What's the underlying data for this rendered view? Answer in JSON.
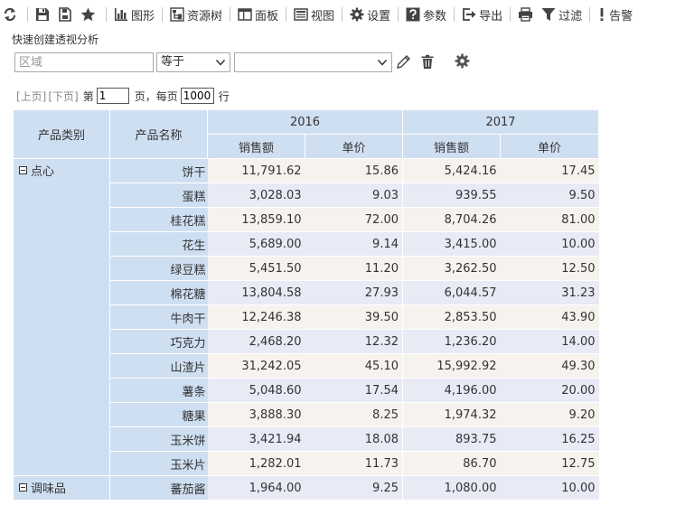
{
  "toolbar": {
    "items": [
      {
        "icon": "refresh-icon",
        "label": ""
      },
      {
        "icon": "save-icon",
        "label": ""
      },
      {
        "icon": "save-as-icon",
        "label": ""
      },
      {
        "icon": "star-icon",
        "label": ""
      },
      {
        "icon": "chart-icon",
        "label": "图形"
      },
      {
        "icon": "resource-tree-icon",
        "label": "资源树"
      },
      {
        "icon": "panel-icon",
        "label": "面板"
      },
      {
        "icon": "view-icon",
        "label": "视图"
      },
      {
        "icon": "gear-icon",
        "label": "设置"
      },
      {
        "icon": "help-icon",
        "label": "参数"
      },
      {
        "icon": "export-icon",
        "label": "导出"
      },
      {
        "icon": "printer-icon",
        "label": ""
      },
      {
        "icon": "filter-icon",
        "label": "过滤"
      },
      {
        "icon": "alert-icon",
        "label": "告警"
      }
    ]
  },
  "subtitle": "快速创建透视分析",
  "filter": {
    "field_placeholder": "区域",
    "operator": "等于",
    "value": ""
  },
  "pager": {
    "prev": "[上页]",
    "next": "[下页]",
    "page_prefix": "第",
    "page": "1",
    "page_suffix": "页，每页",
    "per_page": "1000",
    "per_page_suffix": "行"
  },
  "table": {
    "header": {
      "category": "产品类别",
      "name": "产品名称",
      "years": [
        "2016",
        "2017"
      ],
      "measures": [
        "销售额",
        "单价",
        "销售额",
        "单价"
      ]
    },
    "groups": [
      {
        "name": "点心",
        "rows": [
          {
            "name": "饼干",
            "v": [
              "11,791.62",
              "15.86",
              "5,424.16",
              "17.45"
            ]
          },
          {
            "name": "蛋糕",
            "v": [
              "3,028.03",
              "9.03",
              "939.55",
              "9.50"
            ]
          },
          {
            "name": "桂花糕",
            "v": [
              "13,859.10",
              "72.00",
              "8,704.26",
              "81.00"
            ]
          },
          {
            "name": "花生",
            "v": [
              "5,689.00",
              "9.14",
              "3,415.00",
              "10.00"
            ]
          },
          {
            "name": "绿豆糕",
            "v": [
              "5,451.50",
              "11.20",
              "3,262.50",
              "12.50"
            ]
          },
          {
            "name": "棉花糖",
            "v": [
              "13,804.58",
              "27.93",
              "6,044.57",
              "31.23"
            ]
          },
          {
            "name": "牛肉干",
            "v": [
              "12,246.38",
              "39.50",
              "2,853.50",
              "43.90"
            ]
          },
          {
            "name": "巧克力",
            "v": [
              "2,468.20",
              "12.32",
              "1,236.20",
              "14.00"
            ]
          },
          {
            "name": "山渣片",
            "v": [
              "31,242.05",
              "45.10",
              "15,992.92",
              "49.30"
            ]
          },
          {
            "name": "薯条",
            "v": [
              "5,048.60",
              "17.54",
              "4,196.00",
              "20.00"
            ]
          },
          {
            "name": "糖果",
            "v": [
              "3,888.30",
              "8.25",
              "1,974.32",
              "9.20"
            ]
          },
          {
            "name": "玉米饼",
            "v": [
              "3,421.94",
              "18.08",
              "893.75",
              "16.25"
            ]
          },
          {
            "name": "玉米片",
            "v": [
              "1,282.01",
              "11.73",
              "86.70",
              "12.75"
            ]
          }
        ]
      },
      {
        "name": "调味品",
        "rows": [
          {
            "name": "蕃茄酱",
            "v": [
              "1,964.00",
              "9.25",
              "1,080.00",
              "10.00"
            ]
          }
        ]
      }
    ]
  }
}
